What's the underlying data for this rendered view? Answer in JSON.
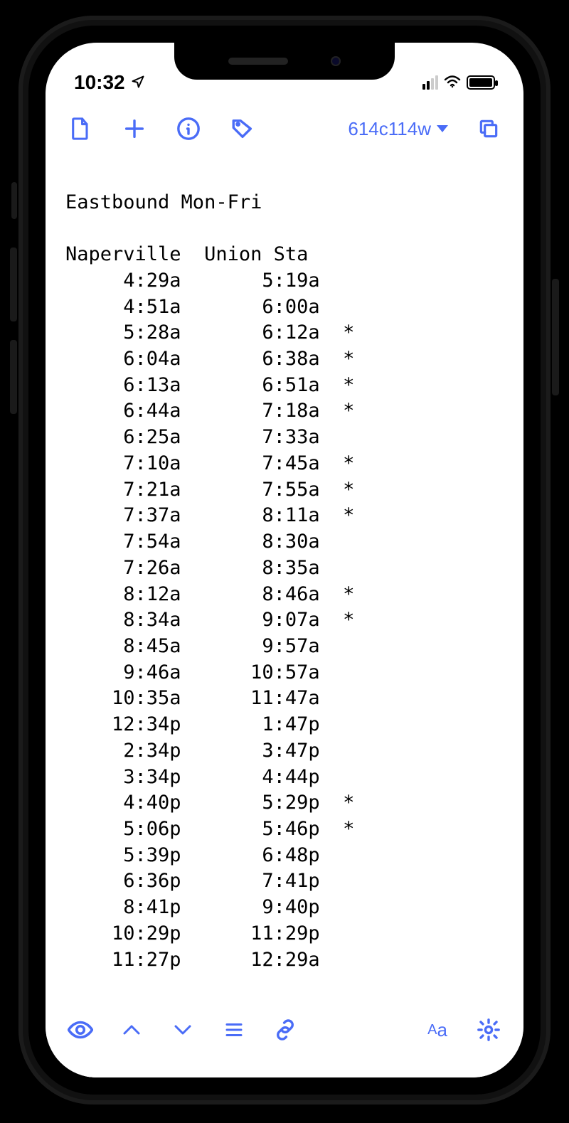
{
  "status": {
    "time": "10:32",
    "location_arrow": true
  },
  "toolbar": {
    "branch_label": "614c114w"
  },
  "schedule": {
    "title": "Eastbound Mon-Fri",
    "columns": [
      "Naperville",
      "Union Sta"
    ],
    "rows": [
      {
        "dep": "4:29a",
        "arr": "5:19a",
        "flag": ""
      },
      {
        "dep": "4:51a",
        "arr": "6:00a",
        "flag": ""
      },
      {
        "dep": "5:28a",
        "arr": "6:12a",
        "flag": "*"
      },
      {
        "dep": "6:04a",
        "arr": "6:38a",
        "flag": "*"
      },
      {
        "dep": "6:13a",
        "arr": "6:51a",
        "flag": "*"
      },
      {
        "dep": "6:44a",
        "arr": "7:18a",
        "flag": "*"
      },
      {
        "dep": "6:25a",
        "arr": "7:33a",
        "flag": ""
      },
      {
        "dep": "7:10a",
        "arr": "7:45a",
        "flag": "*"
      },
      {
        "dep": "7:21a",
        "arr": "7:55a",
        "flag": "*"
      },
      {
        "dep": "7:37a",
        "arr": "8:11a",
        "flag": "*"
      },
      {
        "dep": "7:54a",
        "arr": "8:30a",
        "flag": ""
      },
      {
        "dep": "7:26a",
        "arr": "8:35a",
        "flag": ""
      },
      {
        "dep": "8:12a",
        "arr": "8:46a",
        "flag": "*"
      },
      {
        "dep": "8:34a",
        "arr": "9:07a",
        "flag": "*"
      },
      {
        "dep": "8:45a",
        "arr": "9:57a",
        "flag": ""
      },
      {
        "dep": "9:46a",
        "arr": "10:57a",
        "flag": ""
      },
      {
        "dep": "10:35a",
        "arr": "11:47a",
        "flag": ""
      },
      {
        "dep": "12:34p",
        "arr": "1:47p",
        "flag": ""
      },
      {
        "dep": "2:34p",
        "arr": "3:47p",
        "flag": ""
      },
      {
        "dep": "3:34p",
        "arr": "4:44p",
        "flag": ""
      },
      {
        "dep": "4:40p",
        "arr": "5:29p",
        "flag": "*"
      },
      {
        "dep": "5:06p",
        "arr": "5:46p",
        "flag": "*"
      },
      {
        "dep": "5:39p",
        "arr": "6:48p",
        "flag": ""
      },
      {
        "dep": "6:36p",
        "arr": "7:41p",
        "flag": ""
      },
      {
        "dep": "8:41p",
        "arr": "9:40p",
        "flag": ""
      },
      {
        "dep": "10:29p",
        "arr": "11:29p",
        "flag": ""
      },
      {
        "dep": "11:27p",
        "arr": "12:29a",
        "flag": ""
      }
    ]
  }
}
